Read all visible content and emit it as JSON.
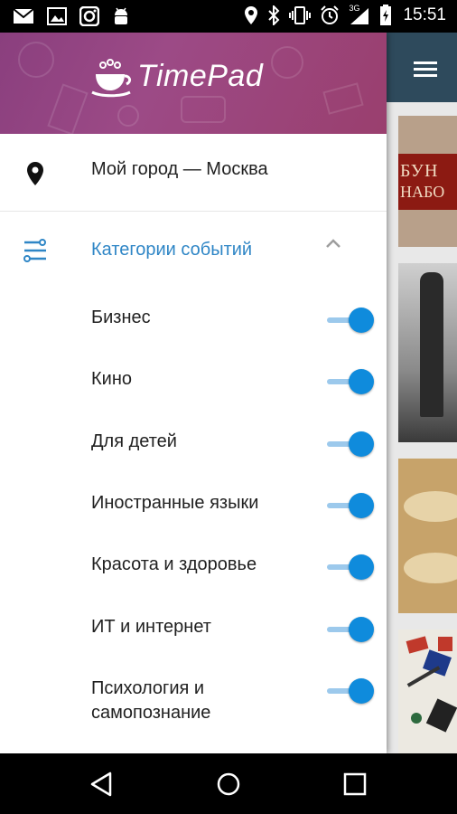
{
  "status_bar": {
    "time": "15:51",
    "network_label": "3G",
    "left_icons": [
      "mail-icon",
      "image-icon",
      "instagram-icon",
      "android-icon"
    ],
    "right_icons": [
      "location-icon",
      "bluetooth-icon",
      "vibrate-icon",
      "alarm-icon",
      "signal-icon",
      "battery-icon"
    ]
  },
  "drawer": {
    "brand": "TimePad",
    "brand_color": "#9a4583",
    "city_label": "Мой город — Москва",
    "categories_label": "Категории событий",
    "accent_color": "#2f86c6",
    "categories": [
      {
        "label": "Бизнес",
        "enabled": true
      },
      {
        "label": "Кино",
        "enabled": true
      },
      {
        "label": "Для детей",
        "enabled": true
      },
      {
        "label": "Иностранные языки",
        "enabled": true
      },
      {
        "label": "Красота и здоровье",
        "enabled": true
      },
      {
        "label": "ИТ и интернет",
        "enabled": true
      },
      {
        "label": "Психология и самопознание",
        "enabled": true
      }
    ]
  },
  "background_app": {
    "toolbar_color": "#2e4a5c",
    "menu_icon": "hamburger-icon",
    "card1_line1": "БУН",
    "card1_line2": "НАБО"
  },
  "nav_bar": {
    "buttons": [
      "back-icon",
      "home-icon",
      "recents-icon"
    ]
  }
}
